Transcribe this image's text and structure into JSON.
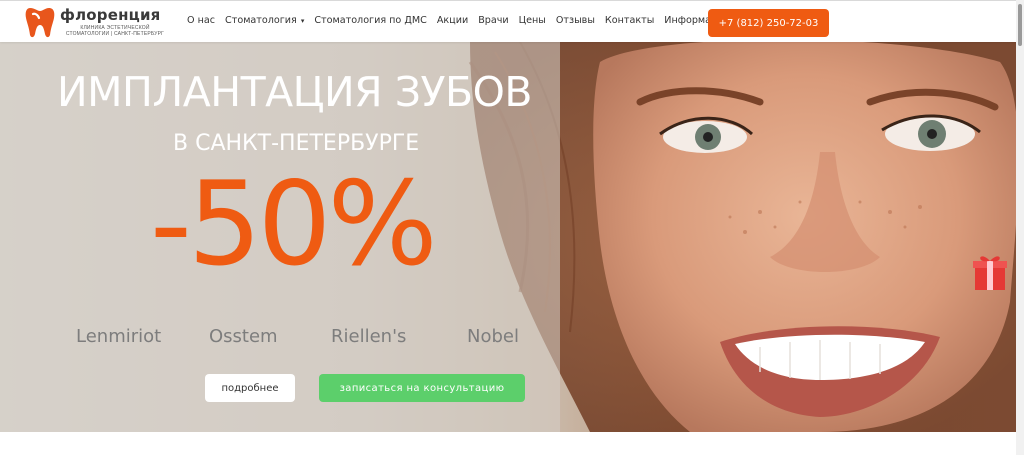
{
  "header": {
    "logo": {
      "name": "флоренция",
      "subtitle": "клиника эстетической стоматологии | санкт-петербург"
    },
    "nav": [
      {
        "label": "О нас"
      },
      {
        "label": "Стоматология",
        "has_dropdown": true
      },
      {
        "label": "Стоматология по ДМС"
      },
      {
        "label": "Акции"
      },
      {
        "label": "Врачи"
      },
      {
        "label": "Цены"
      },
      {
        "label": "Отзывы"
      },
      {
        "label": "Контакты"
      },
      {
        "label": "Информация"
      }
    ],
    "phone": "+7 (812) 250-72-03"
  },
  "hero": {
    "title": "ИМПЛАНТАЦИЯ ЗУБОВ",
    "subtitle": "В САНКТ-ПЕТЕРБУРГЕ",
    "discount": "-50%",
    "brands": [
      "Lenmiriot",
      "Osstem",
      "Riellen's",
      "Nobel"
    ],
    "more_button": "подробнее",
    "consult_button": "записаться на консультацию",
    "gift_icon": "gift-box-icon"
  },
  "colors": {
    "accent": "#ef5b12",
    "consult_green": "#5ccf6b",
    "brand_gray": "#7d7d7d",
    "logo_orange": "#e8561c"
  }
}
